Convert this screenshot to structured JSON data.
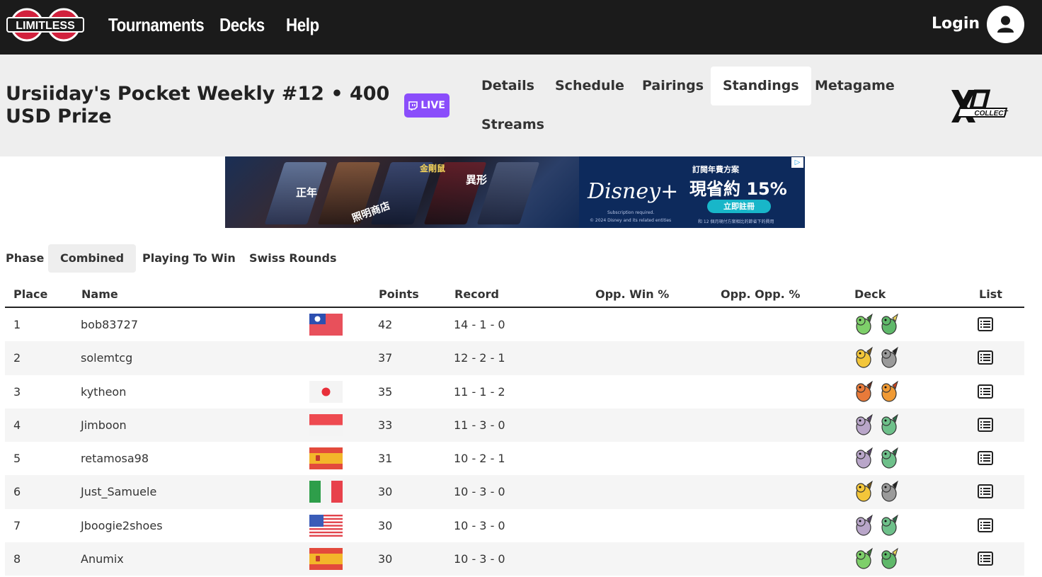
{
  "nav": {
    "logo_text": "LIMITLESS",
    "links": [
      "Tournaments",
      "Decks",
      "Help"
    ],
    "login": "Login"
  },
  "tournament": {
    "title": "Ursiiday's Pocket Weekly #12 • 400 USD Prize",
    "live_badge": "LIVE",
    "tabs": [
      "Details",
      "Schedule",
      "Pairings",
      "Standings",
      "Metagame",
      "Streams"
    ],
    "active_tab": "Standings",
    "sponsor_text": "COLLECT"
  },
  "ad": {
    "brand": "Disney+",
    "headline_small": "訂閱年費方案",
    "headline_big": "現省約 15%",
    "cta": "立即註冊",
    "fine_print_1": "Subscription required.",
    "fine_print_2": "© 2024 Disney and its related entities",
    "fine_print_3": "和 12 個月現付方案相比的節省下的費用",
    "poster_texts": [
      "正年",
      "照明商店",
      "金剛鼠",
      "異形"
    ]
  },
  "phase": {
    "label": "Phase",
    "tabs": [
      "Combined",
      "Playing To Win",
      "Swiss Rounds"
    ],
    "active": "Combined"
  },
  "table": {
    "columns": [
      "Place",
      "Name",
      "Points",
      "Record",
      "Opp. Win %",
      "Opp. Opp. %",
      "Deck",
      "List"
    ],
    "rows": [
      {
        "place": "1",
        "name": "bob83727",
        "flag": "taiwan",
        "points": "42",
        "record": "14 - 1 - 0",
        "deck": [
          "celebi-ex",
          "serperior"
        ]
      },
      {
        "place": "2",
        "name": "solemtcg",
        "flag": "",
        "points": "37",
        "record": "12 - 2 - 1",
        "deck": [
          "pikachu-ex",
          "zebstrika"
        ]
      },
      {
        "place": "3",
        "name": "kytheon",
        "flag": "japan",
        "points": "35",
        "record": "11 - 1 - 2",
        "deck": [
          "charizard-ex",
          "moltres-ex"
        ]
      },
      {
        "place": "4",
        "name": "Jimboon",
        "flag": "indonesia",
        "points": "33",
        "record": "11 - 3 - 0",
        "deck": [
          "mewtwo-ex",
          "gardevoir"
        ]
      },
      {
        "place": "5",
        "name": "retamosa98",
        "flag": "spain",
        "points": "31",
        "record": "10 - 2 - 1",
        "deck": [
          "mewtwo-ex",
          "gardevoir"
        ]
      },
      {
        "place": "6",
        "name": "Just_Samuele",
        "flag": "italy",
        "points": "30",
        "record": "10 - 3 - 0",
        "deck": [
          "pikachu-ex",
          "zebstrika"
        ]
      },
      {
        "place": "7",
        "name": "Jboogie2shoes",
        "flag": "usa",
        "points": "30",
        "record": "10 - 3 - 0",
        "deck": [
          "mewtwo-ex",
          "gardevoir"
        ]
      },
      {
        "place": "8",
        "name": "Anumix",
        "flag": "spain",
        "points": "30",
        "record": "10 - 3 - 0",
        "deck": [
          "celebi-ex",
          "serperior"
        ]
      }
    ]
  },
  "colors": {
    "nav_bg": "#1b1b1b",
    "header_bg": "#eeeeee",
    "live_purple": "#8a4dfb",
    "logo_red": "#d1213d"
  }
}
